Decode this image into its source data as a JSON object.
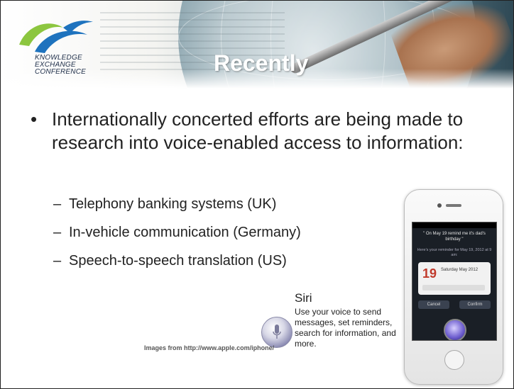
{
  "slide": {
    "logo_lines": [
      "KNOWLEDGE",
      "EXCHANGE",
      "CONFERENCE"
    ],
    "title": "Recently",
    "main_bullet": "Internationally concerted efforts are being made to research into voice-enabled access to information:",
    "sub_bullets": [
      "Telephony banking systems (UK)",
      "In-vehicle communication (Germany)",
      "Speech-to-speech translation (US)"
    ],
    "siri": {
      "title": "Siri",
      "description": "Use your voice to send messages, set reminders, search for information, and more."
    },
    "credit": "Images from http://www.apple.com/iphone/",
    "phone_screen": {
      "message": "\" On May 19 remind me it's dad's birthday \"",
      "reply": "Here's your reminder for May 19, 2012 at 9 am:",
      "day": "19",
      "date": "Saturday May 2012",
      "cancel": "Cancel",
      "confirm": "Confirm"
    }
  }
}
